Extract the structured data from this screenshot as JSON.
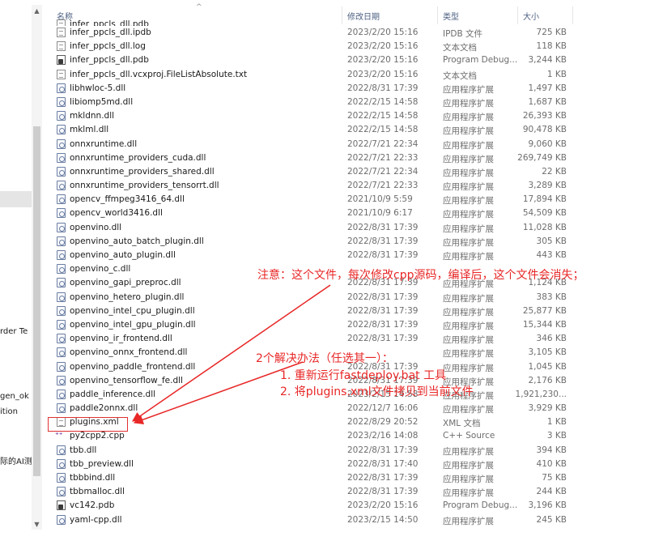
{
  "header": {
    "name": "名称",
    "date": "修改日期",
    "type": "类型",
    "size": "大小",
    "sort_indicator": "^"
  },
  "nav": {
    "fragments": [
      "rder Te",
      "gen_ok",
      "ition",
      "际的AI测"
    ]
  },
  "rows": [
    {
      "name": "infer_ppcls_dll.pdb",
      "date": "",
      "type": "",
      "size": "",
      "icon": "document-icon"
    },
    {
      "name": "infer_ppcls_dll.ipdb",
      "date": "2023/2/20 15:16",
      "type": "IPDB 文件",
      "size": "725 KB",
      "icon": "document-icon"
    },
    {
      "name": "infer_ppcls_dll.log",
      "date": "2023/2/20 15:16",
      "type": "文本文档",
      "size": "118 KB",
      "icon": "text-file-icon"
    },
    {
      "name": "infer_ppcls_dll.pdb",
      "date": "2023/2/20 15:16",
      "type": "Program Debug...",
      "size": "3,244 KB",
      "icon": "pdb-file-icon"
    },
    {
      "name": "infer_ppcls_dll.vcxproj.FileListAbsolute.txt",
      "date": "2023/2/20 15:16",
      "type": "文本文档",
      "size": "1 KB",
      "icon": "text-file-icon"
    },
    {
      "name": "libhwloc-5.dll",
      "date": "2022/8/31 17:39",
      "type": "应用程序扩展",
      "size": "1,497 KB",
      "icon": "dll-file-icon"
    },
    {
      "name": "libiomp5md.dll",
      "date": "2022/2/15 14:58",
      "type": "应用程序扩展",
      "size": "1,687 KB",
      "icon": "dll-file-icon"
    },
    {
      "name": "mkldnn.dll",
      "date": "2022/2/15 14:58",
      "type": "应用程序扩展",
      "size": "26,393 KB",
      "icon": "dll-file-icon"
    },
    {
      "name": "mklml.dll",
      "date": "2022/2/15 14:58",
      "type": "应用程序扩展",
      "size": "90,478 KB",
      "icon": "dll-file-icon"
    },
    {
      "name": "onnxruntime.dll",
      "date": "2022/7/21 22:34",
      "type": "应用程序扩展",
      "size": "9,060 KB",
      "icon": "dll-file-icon"
    },
    {
      "name": "onnxruntime_providers_cuda.dll",
      "date": "2022/7/21 22:33",
      "type": "应用程序扩展",
      "size": "269,749 KB",
      "icon": "dll-file-icon"
    },
    {
      "name": "onnxruntime_providers_shared.dll",
      "date": "2022/7/21 22:34",
      "type": "应用程序扩展",
      "size": "22 KB",
      "icon": "dll-file-icon"
    },
    {
      "name": "onnxruntime_providers_tensorrt.dll",
      "date": "2022/7/21 22:33",
      "type": "应用程序扩展",
      "size": "3,289 KB",
      "icon": "dll-file-icon"
    },
    {
      "name": "opencv_ffmpeg3416_64.dll",
      "date": "2021/10/9 5:59",
      "type": "应用程序扩展",
      "size": "17,894 KB",
      "icon": "dll-file-icon"
    },
    {
      "name": "opencv_world3416.dll",
      "date": "2021/10/9 6:17",
      "type": "应用程序扩展",
      "size": "54,509 KB",
      "icon": "dll-file-icon"
    },
    {
      "name": "openvino.dll",
      "date": "2022/8/31 17:39",
      "type": "应用程序扩展",
      "size": "11,028 KB",
      "icon": "dll-file-icon"
    },
    {
      "name": "openvino_auto_batch_plugin.dll",
      "date": "2022/8/31 17:39",
      "type": "应用程序扩展",
      "size": "305 KB",
      "icon": "dll-file-icon"
    },
    {
      "name": "openvino_auto_plugin.dll",
      "date": "2022/8/31 17:39",
      "type": "应用程序扩展",
      "size": "443 KB",
      "icon": "dll-file-icon"
    },
    {
      "name": "openvino_c.dll",
      "date": "",
      "type": "",
      "size": "",
      "icon": "dll-file-icon"
    },
    {
      "name": "openvino_gapi_preproc.dll",
      "date": "2022/8/31 17:39",
      "type": "应用程序扩展",
      "size": "1,124 KB",
      "icon": "dll-file-icon"
    },
    {
      "name": "openvino_hetero_plugin.dll",
      "date": "2022/8/31 17:39",
      "type": "应用程序扩展",
      "size": "383 KB",
      "icon": "dll-file-icon"
    },
    {
      "name": "openvino_intel_cpu_plugin.dll",
      "date": "2022/8/31 17:39",
      "type": "应用程序扩展",
      "size": "25,877 KB",
      "icon": "dll-file-icon"
    },
    {
      "name": "openvino_intel_gpu_plugin.dll",
      "date": "2022/8/31 17:39",
      "type": "应用程序扩展",
      "size": "15,344 KB",
      "icon": "dll-file-icon"
    },
    {
      "name": "openvino_ir_frontend.dll",
      "date": "2022/8/31 17:39",
      "type": "应用程序扩展",
      "size": "346 KB",
      "icon": "dll-file-icon"
    },
    {
      "name": "openvino_onnx_frontend.dll",
      "date": "",
      "type": "应用程序扩展",
      "size": "3,105 KB",
      "icon": "dll-file-icon"
    },
    {
      "name": "openvino_paddle_frontend.dll",
      "date": "2022/8/31 17:39",
      "type": "应用程序扩展",
      "size": "1,045 KB",
      "icon": "dll-file-icon"
    },
    {
      "name": "openvino_tensorflow_fe.dll",
      "date": "2022/8/31 17:39",
      "type": "应用程序扩展",
      "size": "2,176 KB",
      "icon": "dll-file-icon"
    },
    {
      "name": "paddle_inference.dll",
      "date": "2023/2/15 14:58",
      "type": "应用程序扩展",
      "size": "1,921,230...",
      "icon": "dll-file-icon"
    },
    {
      "name": "paddle2onnx.dll",
      "date": "2022/12/7 16:06",
      "type": "应用程序扩展",
      "size": "3,929 KB",
      "icon": "dll-file-icon"
    },
    {
      "name": "plugins.xml",
      "date": "2022/8/29 20:52",
      "type": "XML 文档",
      "size": "1 KB",
      "icon": "xml-file-icon"
    },
    {
      "name": "py2cpp2.cpp",
      "date": "2023/2/16 14:08",
      "type": "C++ Source",
      "size": "3 KB",
      "icon": "cpp-file-icon"
    },
    {
      "name": "tbb.dll",
      "date": "2022/8/31 17:39",
      "type": "应用程序扩展",
      "size": "394 KB",
      "icon": "dll-file-icon"
    },
    {
      "name": "tbb_preview.dll",
      "date": "2022/8/31 17:40",
      "type": "应用程序扩展",
      "size": "410 KB",
      "icon": "dll-file-icon"
    },
    {
      "name": "tbbbind.dll",
      "date": "2022/8/31 17:39",
      "type": "应用程序扩展",
      "size": "75 KB",
      "icon": "dll-file-icon"
    },
    {
      "name": "tbbmalloc.dll",
      "date": "2022/8/31 17:39",
      "type": "应用程序扩展",
      "size": "244 KB",
      "icon": "dll-file-icon"
    },
    {
      "name": "vc142.pdb",
      "date": "2023/2/20 15:16",
      "type": "Program Debug...",
      "size": "3,196 KB",
      "icon": "pdb-file-icon"
    },
    {
      "name": "yaml-cpp.dll",
      "date": "2023/2/15 14:50",
      "type": "应用程序扩展",
      "size": "245 KB",
      "icon": "dll-file-icon"
    }
  ],
  "annotations": {
    "note1": "注意：这个文件，每次修改cpp源码，编译后，这个文件会消失；",
    "note2": "2个解决办法（任选其一）：",
    "note3": "1. 重新运行fastdeploy.bat 工具",
    "note4": "2. 将plugins.xml文件拷贝到当前文件",
    "color": "#e82727"
  }
}
